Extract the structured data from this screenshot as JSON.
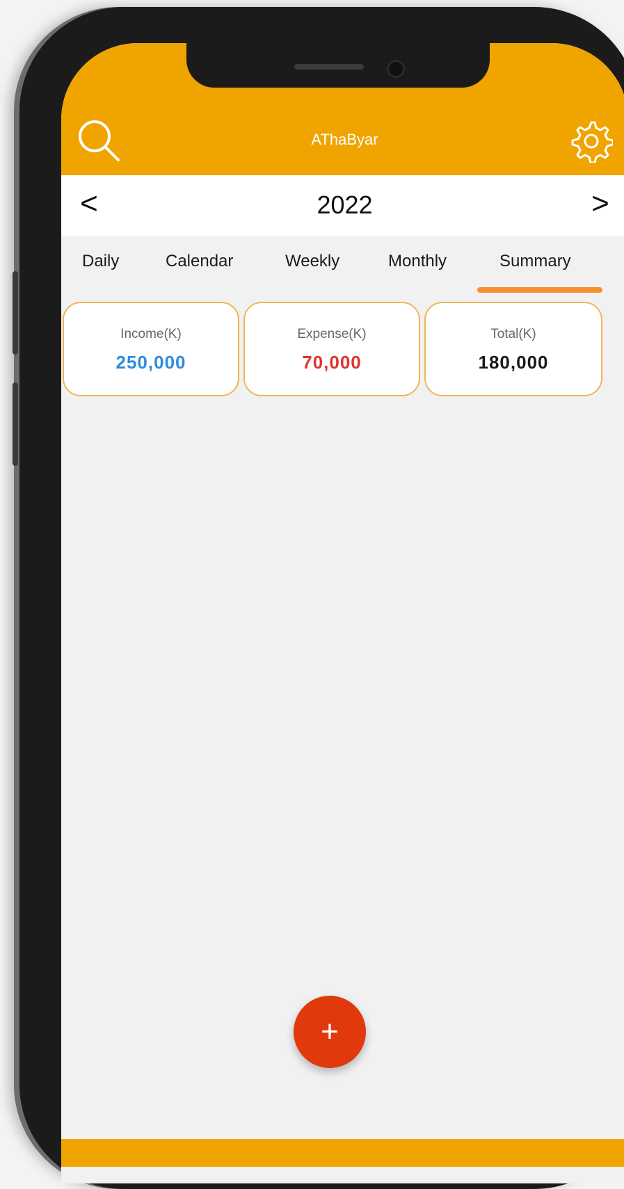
{
  "app": {
    "title": "AThaByar"
  },
  "header": {
    "search_icon": "search-icon",
    "settings_icon": "gear-icon"
  },
  "year_nav": {
    "prev": "<",
    "year": "2022",
    "next": ">"
  },
  "tabs": [
    {
      "label": "Daily",
      "active": false
    },
    {
      "label": "Calendar",
      "active": false
    },
    {
      "label": "Weekly",
      "active": false
    },
    {
      "label": "Monthly",
      "active": false
    },
    {
      "label": "Summary",
      "active": true
    }
  ],
  "summary": {
    "income": {
      "label": "Income(K)",
      "value": "250,000",
      "color": "#2e8be0"
    },
    "expense": {
      "label": "Expense(K)",
      "value": "70,000",
      "color": "#e0332c"
    },
    "total": {
      "label": "Total(K)",
      "value": "180,000",
      "color": "#1a1a1a"
    }
  },
  "fab": {
    "label": "+"
  },
  "colors": {
    "accent": "#f0a400",
    "tab_indicator": "#f5902f",
    "fab": "#e03a0c"
  }
}
